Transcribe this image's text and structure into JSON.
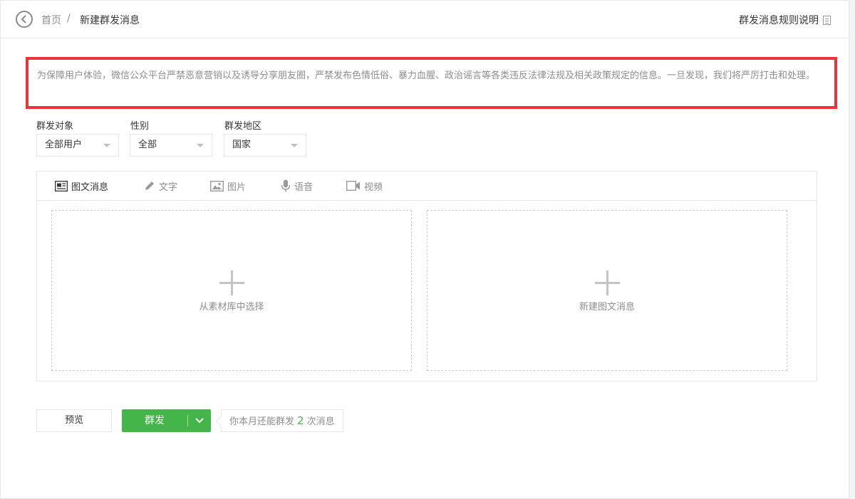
{
  "header": {
    "breadcrumb_home": "首页",
    "breadcrumb_separator": "/",
    "breadcrumb_current": "新建群发消息",
    "rules_link": "群发消息规则说明"
  },
  "notice": {
    "text": "为保障用户体验，微信公众平台严禁恶意营销以及诱导分享朋友圈，严禁发布色情低俗、暴力血腥、政治谣言等各类违反法律法规及相关政策规定的信息。一旦发现，我们将严厉打击和处理。"
  },
  "filters": {
    "target": {
      "label": "群发对象",
      "value": "全部用户"
    },
    "gender": {
      "label": "性别",
      "value": "全部"
    },
    "region": {
      "label": "群发地区",
      "value": "国家"
    }
  },
  "editor": {
    "tabs": [
      {
        "label": "图文消息",
        "icon": "news-icon"
      },
      {
        "label": "文字",
        "icon": "pencil-icon"
      },
      {
        "label": "图片",
        "icon": "image-icon"
      },
      {
        "label": "语音",
        "icon": "microphone-icon"
      },
      {
        "label": "视频",
        "icon": "video-icon"
      }
    ],
    "active_tab": 0,
    "library_label": "从素材库中选择",
    "new_label": "新建图文消息"
  },
  "actions": {
    "preview_label": "预览",
    "send_label": "群发",
    "quota_prefix": "你本月还能群发",
    "quota_count": "2",
    "quota_suffix": "次消息"
  },
  "colors": {
    "accent_green": "#44b549",
    "notice_border": "#ee3239",
    "muted_text": "#8d8d8d"
  }
}
